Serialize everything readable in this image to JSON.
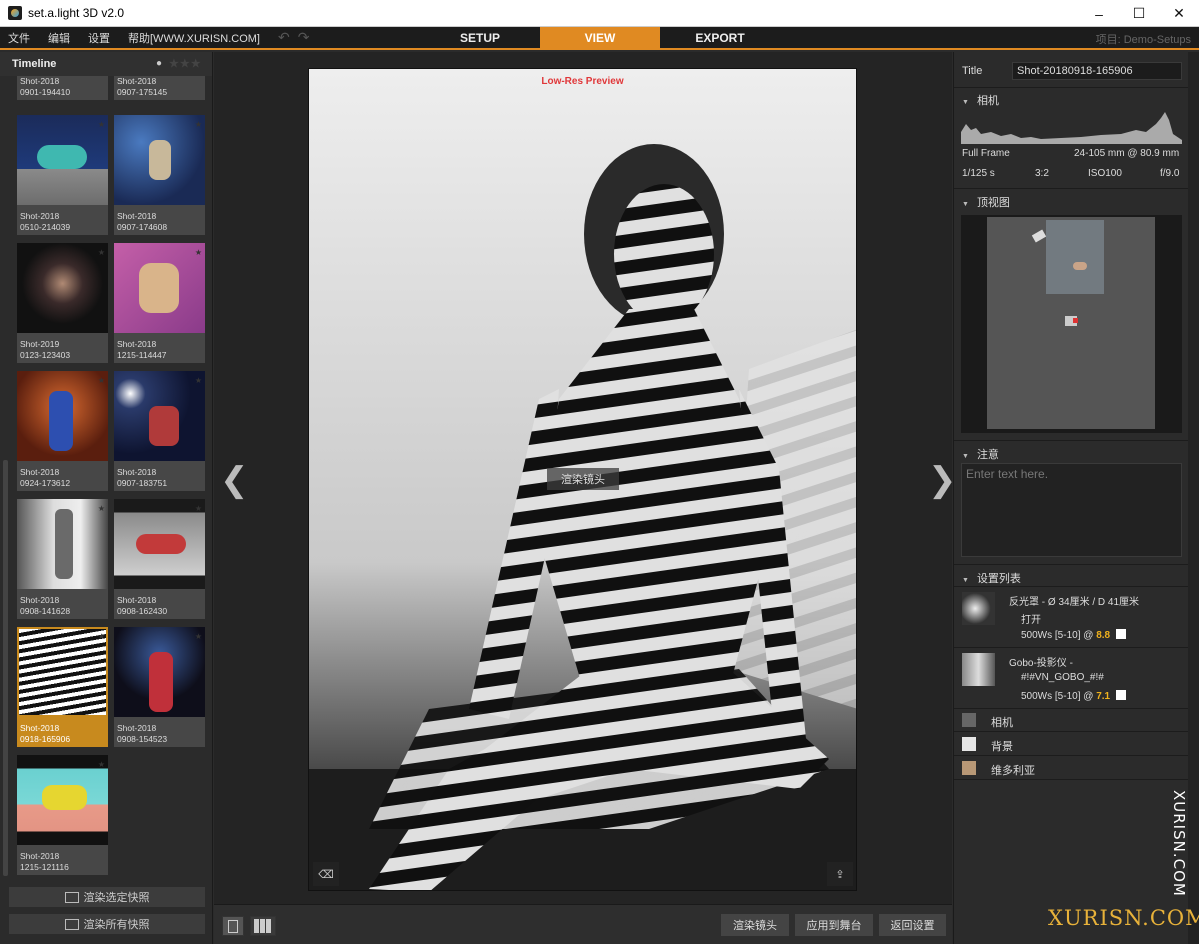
{
  "window": {
    "title": "set.a.light 3D v2.0",
    "minimize": "–",
    "maximize": "☐",
    "close": "✕"
  },
  "menu": {
    "items": [
      "文件",
      "编辑",
      "设置",
      "帮助[WWW.XURISN.COM]"
    ],
    "undo": "↶",
    "redo": "↷"
  },
  "tabs": [
    {
      "label": "SETUP"
    },
    {
      "label": "VIEW",
      "active": true
    },
    {
      "label": "EXPORT"
    }
  ],
  "project_label": "项目: Demo-Setups",
  "timeline": {
    "title": "Timeline",
    "eye": "👁",
    "stars": "★★★",
    "thumbnails": [
      {
        "line1": "Shot-2018",
        "line2": "0901-194410"
      },
      {
        "line1": "Shot-2018",
        "line2": "0907-175145"
      },
      {
        "line1": "Shot-2018",
        "line2": "0510-214039"
      },
      {
        "line1": "Shot-2018",
        "line2": "0907-174608"
      },
      {
        "line1": "Shot-2019",
        "line2": "0123-123403"
      },
      {
        "line1": "Shot-2018",
        "line2": "1215-114447"
      },
      {
        "line1": "Shot-2018",
        "line2": "0924-173612"
      },
      {
        "line1": "Shot-2018",
        "line2": "0907-183751"
      },
      {
        "line1": "Shot-2018",
        "line2": "0908-141628"
      },
      {
        "line1": "Shot-2018",
        "line2": "0908-162430"
      },
      {
        "line1": "Shot-2018",
        "line2": "0918-165906"
      },
      {
        "line1": "Shot-2018",
        "line2": "0908-154523"
      },
      {
        "line1": "Shot-2018",
        "line2": "1215-121116"
      }
    ],
    "thumb_star": "★",
    "render_selected": "渲染选定快照",
    "render_all": "渲染所有快照"
  },
  "preview": {
    "label": "Low-Res Preview",
    "render_overlay": "渲染镜头",
    "prev_arrow": "❮",
    "next_arrow": "❯",
    "trash_icon": "🗑",
    "export_icon": "⇪"
  },
  "bottom": {
    "render_shot": "渲染镜头",
    "apply_stage": "应用到舞台",
    "back_setup": "返回设置"
  },
  "right": {
    "title_label": "Title",
    "title_value": "Shot-20180918-165906",
    "camera": {
      "heading": "相机",
      "sensor": "Full Frame",
      "lens": "24-105 mm @ 80.9 mm",
      "shutter": "1/125 s",
      "ratio": "3:2",
      "iso": "ISO100",
      "aperture": "f/9.0"
    },
    "topview_heading": "顶视图",
    "notes_heading": "注意",
    "notes_placeholder": "Enter text here.",
    "setup_heading": "设置列表",
    "lights": [
      {
        "name": "反光罩 - Ø 34厘米 / D 41厘米",
        "sub": "打开",
        "power": "500Ws [5-10] @",
        "value": "8.8"
      },
      {
        "name": "Gobo-投影仪 -",
        "sub": "#!#VN_GOBO_#!#",
        "power": "500Ws [5-10] @",
        "value": "7.1"
      }
    ],
    "list": [
      "相机",
      "背景",
      "维多利亚"
    ]
  },
  "watermark": {
    "vertical": "XURISN.COM",
    "horizontal": "XURISN.COM"
  },
  "triangle": "▼"
}
